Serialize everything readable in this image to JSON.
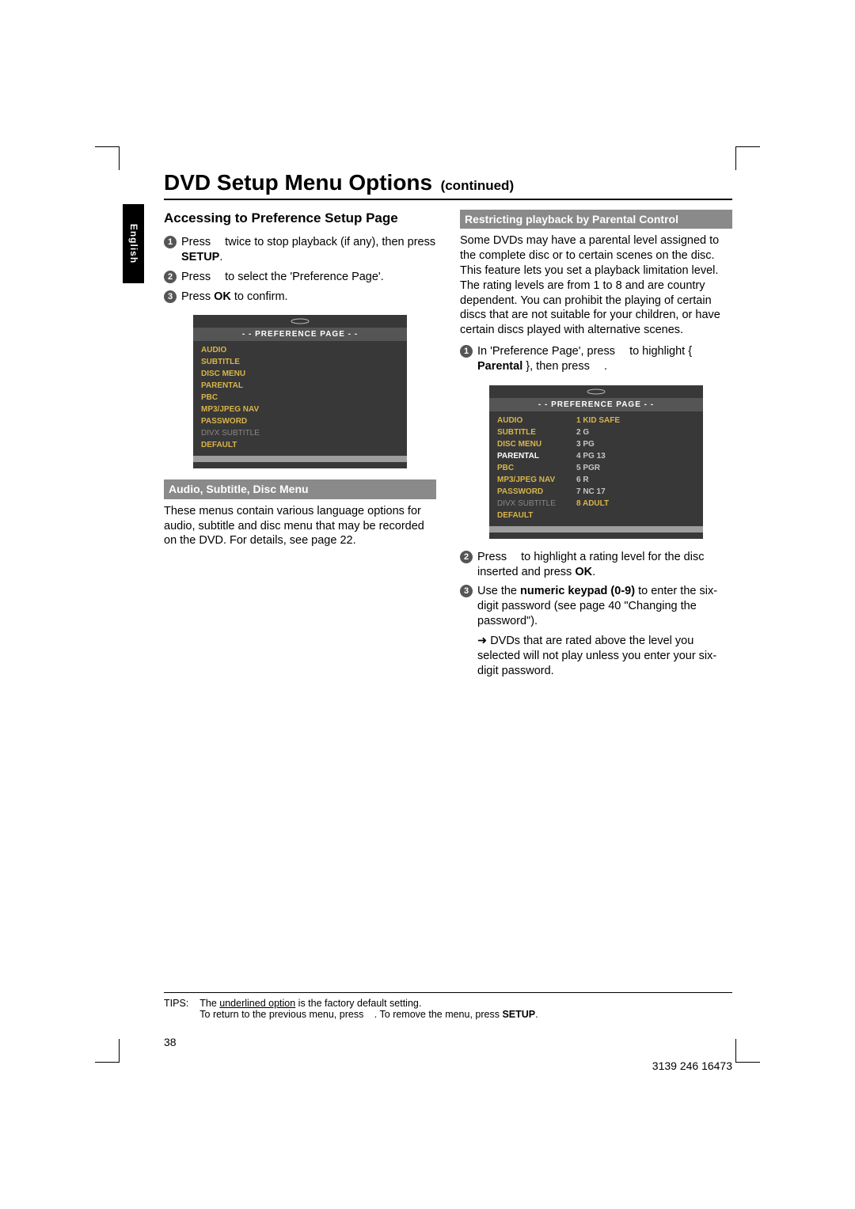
{
  "language_tab": "English",
  "title_main": "DVD Setup Menu Options",
  "title_cont": "(continued)",
  "left": {
    "heading": "Accessing to Preference Setup Page",
    "step1_a": "Press ",
    "step1_b": " twice to stop playback (if any), then press ",
    "step1_setup": "SETUP",
    "step1_c": ".",
    "step2_a": "Press ",
    "step2_b": " to select the 'Preference Page'.",
    "step3_a": "Press ",
    "step3_ok": "OK",
    "step3_b": " to confirm.",
    "osd_header": "- -   PREFERENCE  PAGE   - -",
    "osd_items": [
      "AUDIO",
      "SUBTITLE",
      "DISC MENU",
      "PARENTAL",
      "PBC",
      "MP3/JPEG NAV",
      "PASSWORD",
      "DIVX SUBTITLE",
      "DEFAULT"
    ],
    "sect_bar": "Audio, Subtitle, Disc Menu",
    "sect_text": "These menus contain various language options for audio, subtitle and disc menu that may be recorded on the DVD.  For details, see page 22."
  },
  "right": {
    "sect_bar": "Restricting playback by Parental Control",
    "intro": "Some DVDs may have a parental level assigned to the complete disc or to certain scenes on the disc.  This feature lets you set a playback limitation level. The rating levels are from 1 to 8 and are country dependent. You can prohibit the playing of certain discs that are not suitable for your children, or have certain discs played with alternative scenes.",
    "step1_a": "In 'Preference Page', press ",
    "step1_b": " to highlight { ",
    "step1_parental": "Parental",
    "step1_c": " }, then press ",
    "step1_d": ".",
    "osd_header": "- -   PREFERENCE  PAGE   - -",
    "osd_left": [
      "AUDIO",
      "SUBTITLE",
      "DISC MENU",
      "PARENTAL",
      "PBC",
      "MP3/JPEG NAV",
      "PASSWORD",
      "DIVX SUBTITLE",
      "DEFAULT"
    ],
    "osd_right": [
      "1  KID SAFE",
      "2  G",
      "3  PG",
      "4  PG 13",
      "5  PGR",
      "6  R",
      "7  NC 17",
      "8  ADULT"
    ],
    "step2_a": "Press ",
    "step2_b": " to highlight a rating level for the disc inserted and press ",
    "step2_ok": "OK",
    "step2_c": ".",
    "step3_a": "Use the ",
    "step3_bold": "numeric keypad (0-9)",
    "step3_b": " to enter the six-digit password (see page 40 \"Changing the password\").",
    "step3_note": "DVDs that are rated above the level you selected will not play unless you enter your six-digit password."
  },
  "tips": {
    "label": "TIPS:",
    "line1_a": "The ",
    "line1_u": "underlined option",
    "line1_b": " is the factory default setting.",
    "line2_a": "To return to the previous menu, press ",
    "line2_b": ".  To remove the menu, press ",
    "line2_setup": "SETUP",
    "line2_c": "."
  },
  "page_number": "38",
  "doc_code": "3139 246 16473"
}
